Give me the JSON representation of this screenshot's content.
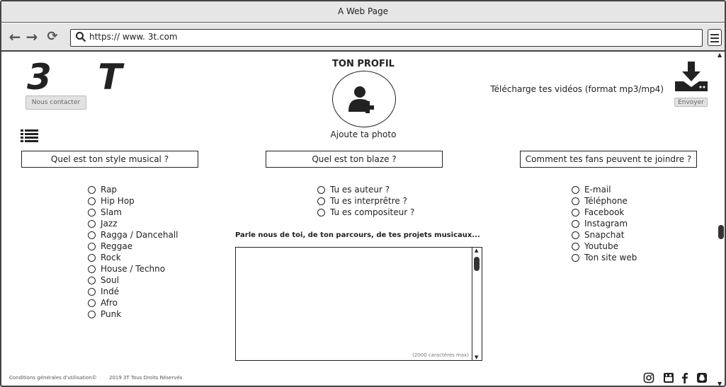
{
  "window": {
    "title": "A Web Page"
  },
  "browser": {
    "url_scheme": "https://",
    "url": "www. 3t.com"
  },
  "header": {
    "logo": "3 T",
    "contact_label": "Nous contacter",
    "profile_title": "TON PROFIL",
    "photo_label": "Ajoute ta photo",
    "download_text": "Télécharge tes vidéos (format mp3/mp4)",
    "send_label": "Envoyer"
  },
  "sections": {
    "style": {
      "question": "Quel est ton style musical ?",
      "options": [
        "Rap",
        "Hip Hop",
        "Slam",
        "Jazz",
        "Ragga / Dancehall",
        "Reggae",
        "Rock",
        "House / Techno",
        "Soul",
        "Indé",
        "Afro",
        "Punk"
      ]
    },
    "blaze": {
      "question": "Quel est ton blaze ?",
      "options": [
        "Tu es auteur ?",
        "Tu es interprêtre ?",
        "Tu es compositeur ?"
      ],
      "about_label": "Parle nous de toi, de ton parcours, de tes projets musicaux...",
      "about_value": "",
      "counter": "(2000 caractères max)"
    },
    "contact": {
      "question": "Comment tes fans peuvent te joindre ?",
      "options": [
        "E-mail",
        "Téléphone",
        "Facebook",
        "Instagram",
        "Snapchat",
        "Youtube",
        "Ton site web"
      ]
    }
  },
  "footer": {
    "terms": "Conditions générales d'utilisation©",
    "copyright": "2019 3T Tous Droits Réservés",
    "social_icons": [
      "instagram-icon",
      "youtube-icon",
      "facebook-icon",
      "snapchat-icon"
    ]
  }
}
